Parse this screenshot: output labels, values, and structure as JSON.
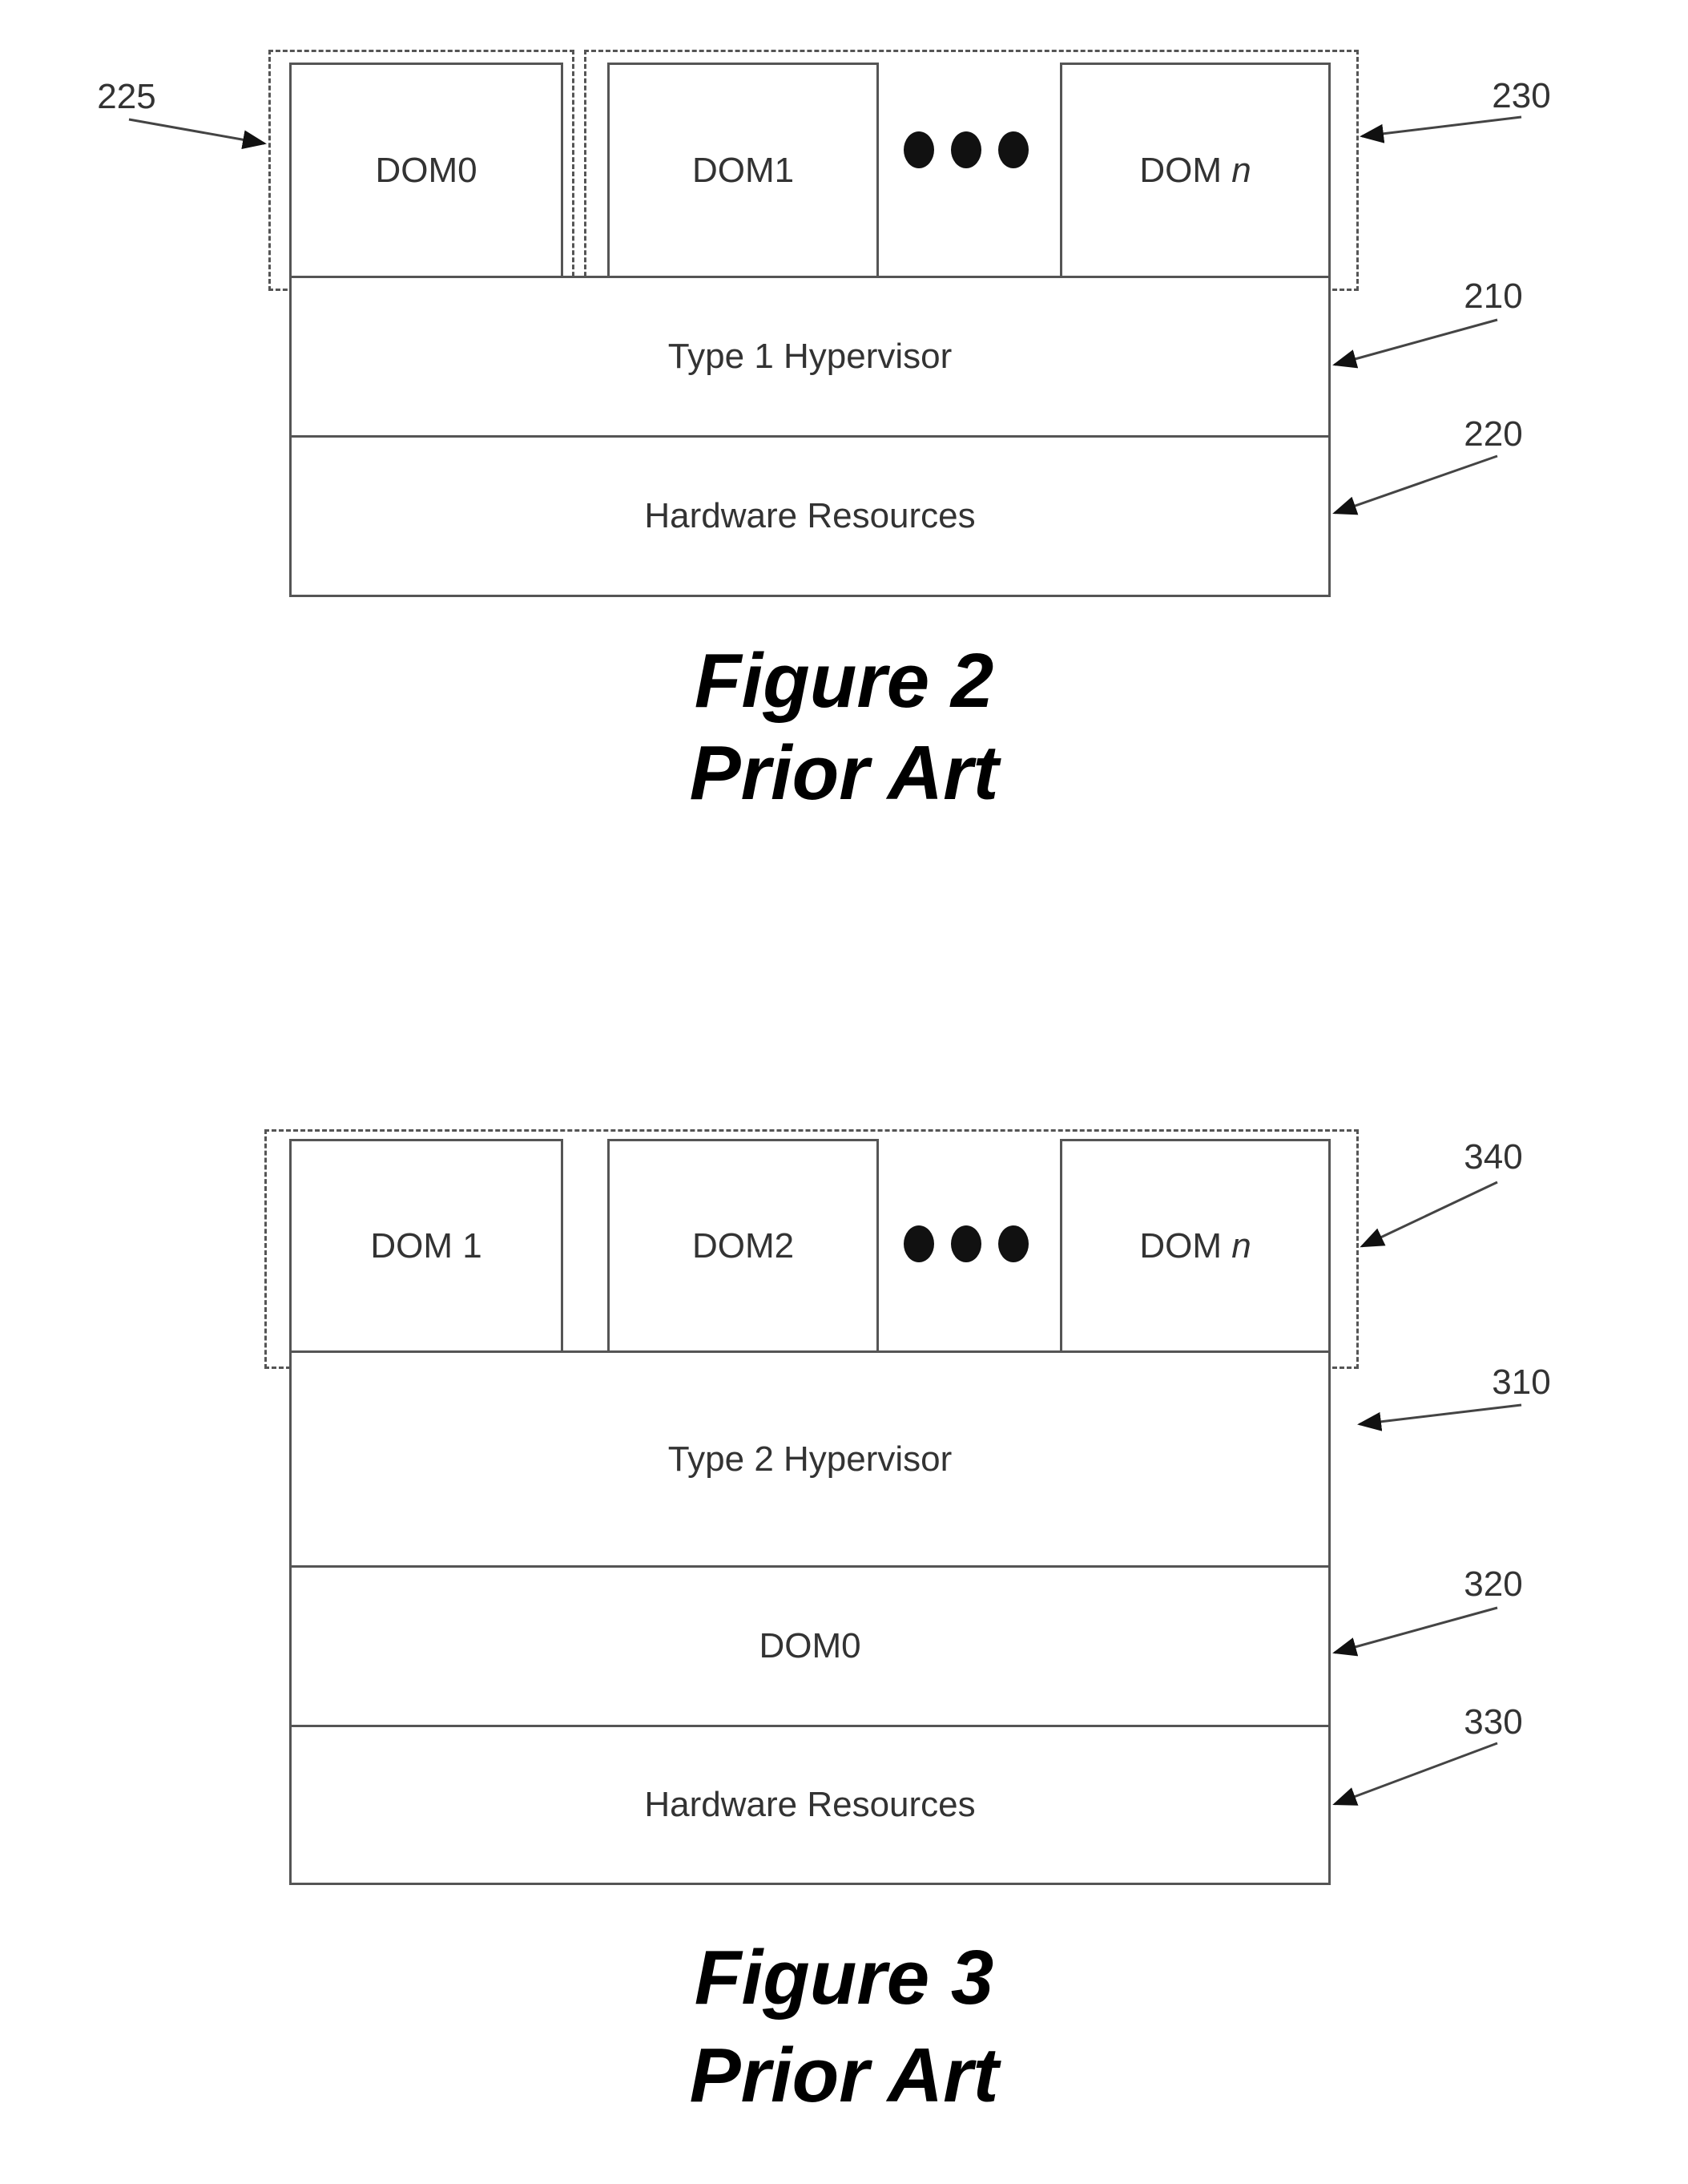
{
  "figures": [
    {
      "caption": "Figure 2",
      "subcaption": "Prior Art",
      "domains": [
        "DOM0",
        "DOM1",
        "DOM",
        "n"
      ],
      "ellipsis_icon": "three-dots",
      "layers": [
        "Type 1 Hypervisor",
        "Hardware Resources"
      ],
      "refs": [
        "225",
        "230",
        "210",
        "220"
      ]
    },
    {
      "caption": "Figure 3",
      "subcaption": "Prior Art",
      "domains": [
        "DOM 1",
        "DOM2",
        "DOM",
        "n"
      ],
      "ellipsis_icon": "three-dots",
      "layers": [
        "Type 2 Hypervisor",
        "DOM0",
        "Hardware Resources"
      ],
      "refs": [
        "340",
        "310",
        "320",
        "330"
      ]
    }
  ]
}
